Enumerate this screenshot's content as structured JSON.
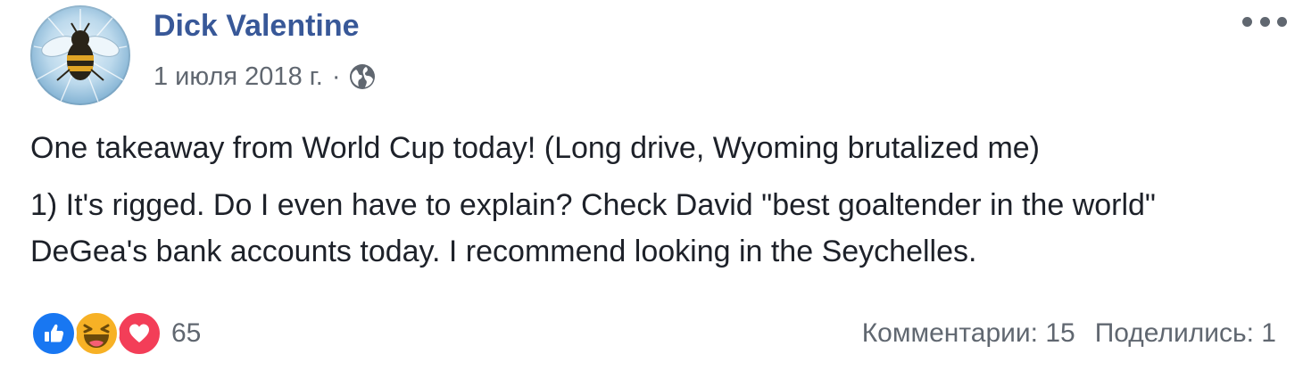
{
  "post": {
    "author": "Dick Valentine",
    "date": "1 июля 2018 г.",
    "separator": "·",
    "privacy_icon": "globe-icon",
    "menu_icon": "more-horizontal-icon",
    "paragraphs": [
      "One takeaway from World Cup today! (Long drive, Wyoming brutalized me)",
      "1) It's rigged. Do I even have to explain? Check David \"best goaltender in the world\" DeGea's bank accounts today. I recommend looking in the Seychelles."
    ]
  },
  "footer": {
    "reaction_icons": [
      "like-icon",
      "haha-icon",
      "love-icon"
    ],
    "reaction_count": "65",
    "comments": "Комментарии: 15",
    "shares": "Поделились: 1"
  },
  "colors": {
    "author_link": "#385898",
    "secondary_text": "#606770",
    "body_text": "#1d2129",
    "like_blue": "#1877f2",
    "haha_yellow": "#f7b125",
    "love_red": "#f33e58"
  }
}
